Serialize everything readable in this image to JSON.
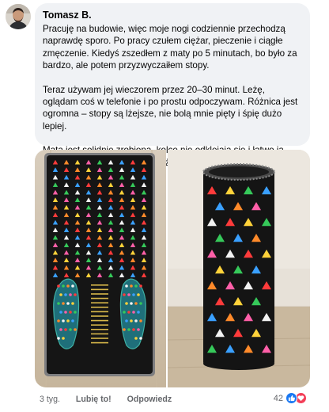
{
  "comment": {
    "author": "Tomasz B.",
    "paragraphs": [
      "Pracuję na budowie, więc moje nogi codziennie przechodzą naprawdę sporo. Po pracy czułem ciężar, pieczenie i ciągłe zmęczenie. Kiedyś zszedłem z maty po 5 minutach, bo było za bardzo, ale potem przyzwyczaiłem stopy.",
      "Teraz używam jej wieczorem przez 20–30 minut. Leżę, oglądam coś w telefonie i po prostu odpoczywam. Różnica jest ogromna – stopy są lżejsze, nie bolą mnie pięty i śpię dużo lepiej.",
      "Mata jest solidnie zrobiona, kolce nie odklejają się i łatwo ją zwinąć po użyciu. Polecam każdemu, kto ma zmęczone nogi!"
    ],
    "time": "3 tyg.",
    "like_label": "Lubię to!",
    "reply_label": "Odpowiedz",
    "reaction_count": "42",
    "reaction_icons": [
      "like-icon",
      "love-icon"
    ]
  },
  "colors": {
    "bubble": "#f0f2f5",
    "meta_text": "#65676b",
    "like": "#1877f2",
    "love": "#f33e58"
  },
  "photos": [
    "massage-mat-flat-photo",
    "massage-mat-rolled-photo"
  ]
}
